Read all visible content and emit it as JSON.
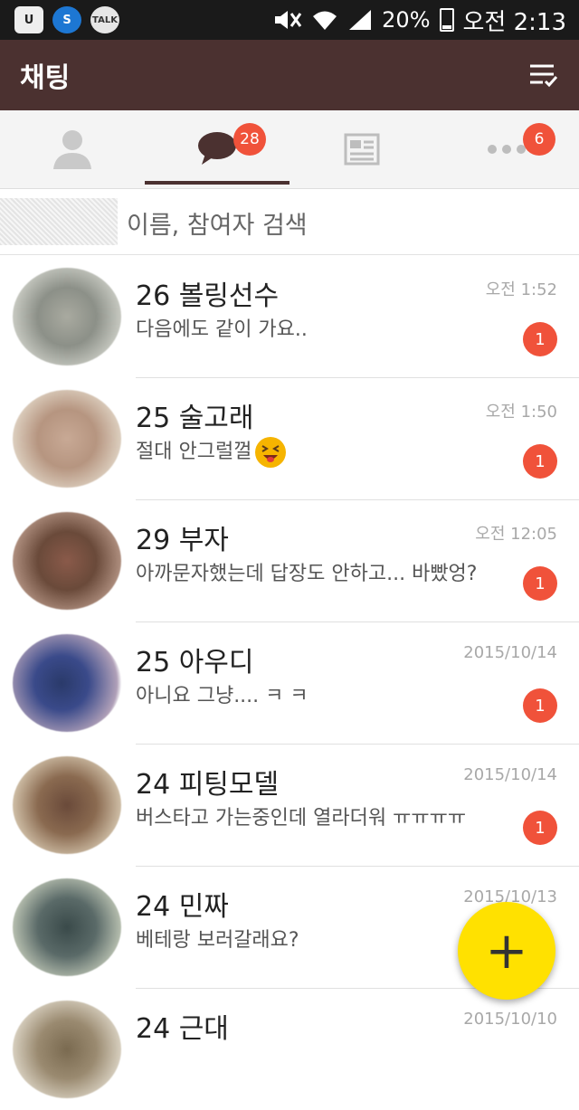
{
  "status": {
    "battery": "20%",
    "time": "오전 2:13",
    "talk_label": "TALK"
  },
  "header": {
    "title": "채팅"
  },
  "tabs": {
    "chats_badge": "28",
    "more_badge": "6"
  },
  "search": {
    "placeholder": "이름, 참여자 검색"
  },
  "chats": [
    {
      "name": "26 볼링선수",
      "message": "다음에도 같이 가요..",
      "time": "오전 1:52",
      "unread": "1"
    },
    {
      "name": "25 술고래",
      "message": "절대 안그럴껄",
      "time": "오전 1:50",
      "unread": "1"
    },
    {
      "name": "29 부자",
      "message": "아까문자했는데 답장도 안하고... 바빴엉?",
      "time": "오전 12:05",
      "unread": "1"
    },
    {
      "name": "25 아우디",
      "message": "아니요 그냥.... ㅋ ㅋ",
      "time": "2015/10/14",
      "unread": "1"
    },
    {
      "name": "24 피팅모델",
      "message": "버스타고 가는중인데 열라더워 ㅠㅠㅠㅠ",
      "time": "2015/10/14",
      "unread": "1"
    },
    {
      "name": "24 민짜",
      "message": "베테랑 보러갈래요?",
      "time": "2015/10/13",
      "unread": ""
    },
    {
      "name": "24 근대",
      "message": "",
      "time": "2015/10/10",
      "unread": ""
    }
  ],
  "fab": {
    "label": "+"
  },
  "colors": {
    "header_bg": "#4b3130",
    "badge": "#f0523a",
    "fab": "#ffe100"
  }
}
